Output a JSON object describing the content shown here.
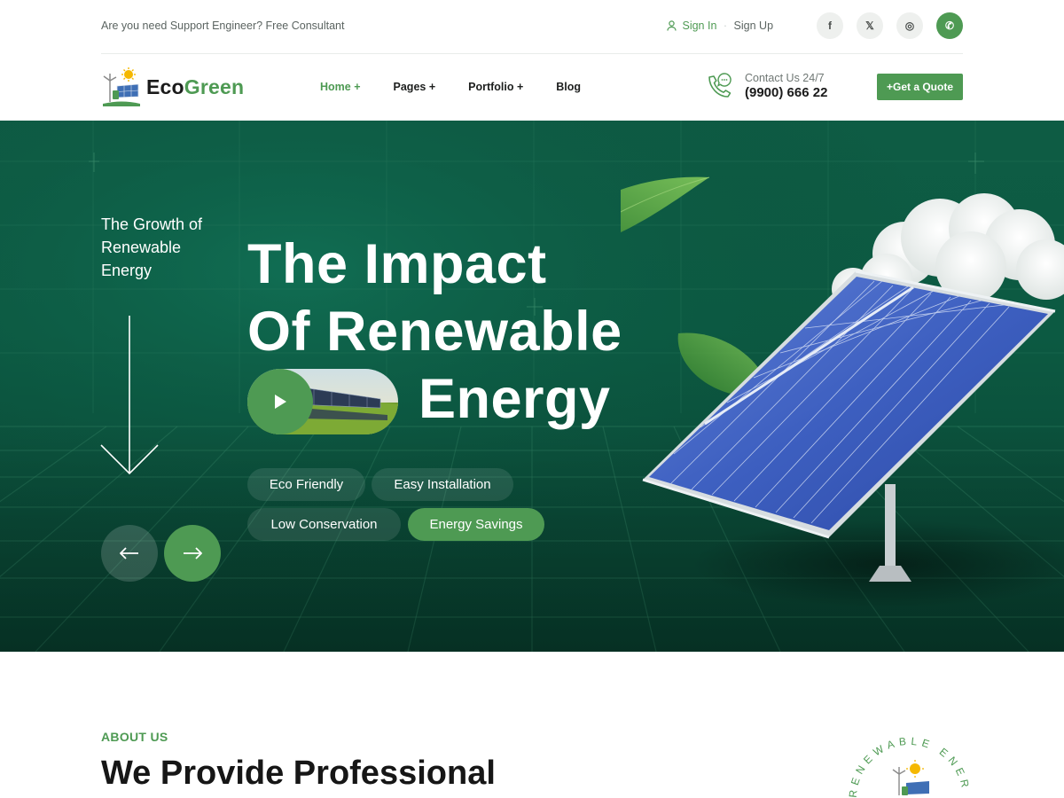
{
  "topbar": {
    "support_text": "Are you need Support Engineer? Free Consultant",
    "sign_in": "Sign In",
    "sign_up": "Sign Up",
    "socials": [
      {
        "icon": "facebook-icon",
        "glyph": "f"
      },
      {
        "icon": "x-twitter-icon",
        "glyph": "𝕏"
      },
      {
        "icon": "instagram-icon",
        "glyph": "◎"
      },
      {
        "icon": "whatsapp-icon",
        "glyph": "✆"
      }
    ]
  },
  "navbar": {
    "brand_eco": "Eco",
    "brand_green": "Green",
    "menu": [
      "Home +",
      "Pages +",
      "Portfolio +",
      "Blog"
    ],
    "active_index": 0,
    "contact_label": "Contact Us 24/7",
    "contact_phone": "(9900) 666 22",
    "quote_button": "+Get a Quote"
  },
  "hero": {
    "side_text": "The Growth of Renewable Energy",
    "title_line1": "The Impact",
    "title_line2": "Of Renewable",
    "title_line3": "Energy",
    "tags": [
      {
        "label": "Eco Friendly",
        "active": false
      },
      {
        "label": "Easy Installation",
        "active": false
      },
      {
        "label": "Low Conservation",
        "active": false
      },
      {
        "label": "Energy Savings",
        "active": true
      }
    ]
  },
  "about": {
    "eyebrow": "ABOUT US",
    "title": "We Provide Professional",
    "badge_text": "RENEWABLE ENER"
  },
  "colors": {
    "accent": "#4e9a53",
    "hero_bg": "#0c5a42",
    "text_dark": "#1b1b1b"
  }
}
